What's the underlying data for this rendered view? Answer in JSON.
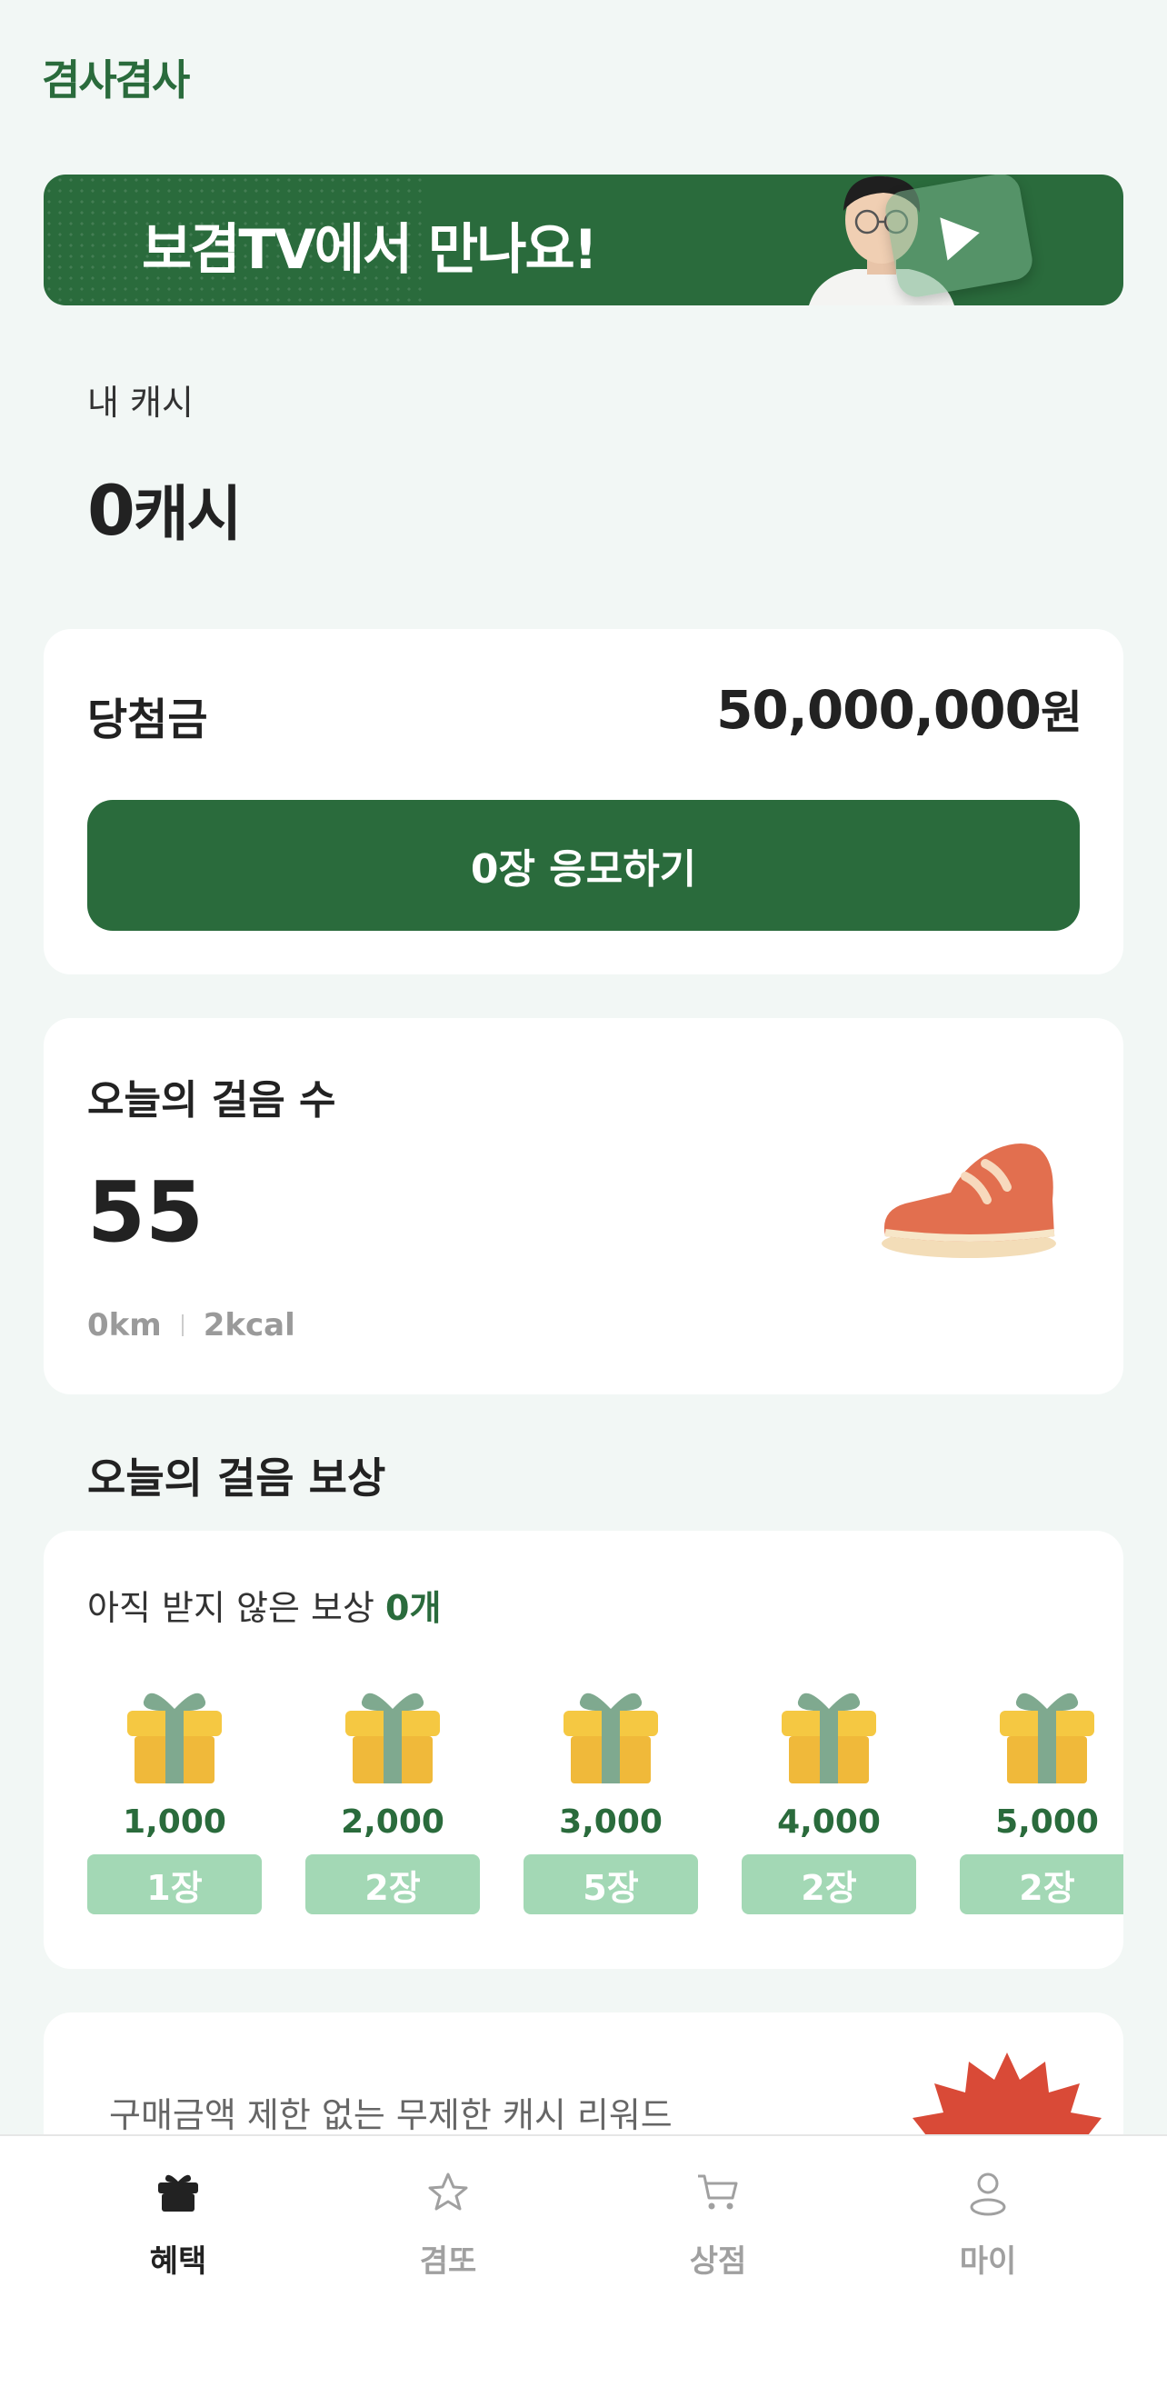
{
  "app": {
    "logo": "겸사겸사"
  },
  "banner": {
    "text": "보겸TV에서 만나요!",
    "bg_color": "#2a6b3c",
    "icon": "play-icon"
  },
  "cash": {
    "label": "내 캐시",
    "value": "0",
    "unit": "캐시"
  },
  "prize": {
    "label": "당첨금",
    "amount": "50,000,000",
    "currency": "원",
    "apply_button": "0장 응모하기"
  },
  "steps": {
    "title": "오늘의 걸음 수",
    "count": "55",
    "distance": "0km",
    "calories": "2kcal",
    "icon": "sneaker-icon"
  },
  "reward": {
    "section_title": "오늘의 걸음 보상",
    "pending_label": "아직 받지 않은 보상",
    "pending_count": "0개",
    "items": [
      {
        "steps": "1,000",
        "tickets": "1장"
      },
      {
        "steps": "2,000",
        "tickets": "2장"
      },
      {
        "steps": "3,000",
        "tickets": "5장"
      },
      {
        "steps": "4,000",
        "tickets": "2장"
      },
      {
        "steps": "5,000",
        "tickets": "2장"
      }
    ]
  },
  "promo": {
    "text": "구매금액 제한 없는 무제한 캐시 리워드"
  },
  "tabs": [
    {
      "label": "혜택",
      "icon": "gift-icon",
      "active": true
    },
    {
      "label": "겸또",
      "icon": "star-icon",
      "active": false
    },
    {
      "label": "상점",
      "icon": "cart-icon",
      "active": false
    },
    {
      "label": "마이",
      "icon": "person-icon",
      "active": false
    }
  ],
  "colors": {
    "brand": "#2a6b3c",
    "badge": "#a3d8b5",
    "background": "#f2f7f5"
  }
}
